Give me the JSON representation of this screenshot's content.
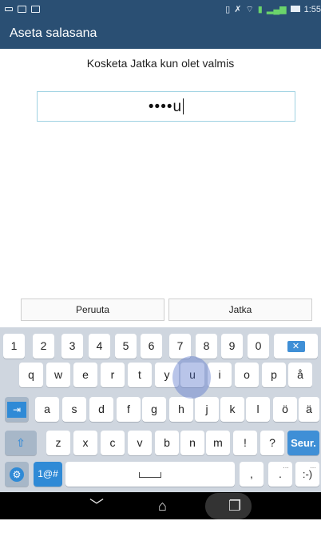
{
  "status_bar": {
    "time": "1:55",
    "icons": [
      "notification-icon",
      "image-icon",
      "vibrate-icon",
      "mute-icon",
      "wifi-icon",
      "sim-icon",
      "signal-icon",
      "battery-icon"
    ]
  },
  "app_bar": {
    "title": "Aseta salasana"
  },
  "prompt": "Kosketa Jatka kun olet valmis",
  "password_field": {
    "value": "••••u"
  },
  "buttons": {
    "cancel": "Peruuta",
    "next": "Jatka"
  },
  "keyboard": {
    "row1": [
      "1",
      "2",
      "3",
      "4",
      "5",
      "6",
      "7",
      "8",
      "9",
      "0"
    ],
    "row2": [
      "q",
      "w",
      "e",
      "r",
      "t",
      "y",
      "u",
      "i",
      "o",
      "p",
      "å"
    ],
    "row3": [
      "a",
      "s",
      "d",
      "f",
      "g",
      "h",
      "j",
      "k",
      "l",
      "ö",
      "ä"
    ],
    "row4": [
      "z",
      "x",
      "c",
      "v",
      "b",
      "n",
      "m",
      "!",
      "?"
    ],
    "enter_label": "Seur.",
    "symbols_label": "1@#",
    "comma": ",",
    "period": ".",
    "smiley": ":-)",
    "hint": "…"
  },
  "colors": {
    "header": "#2a4f73",
    "keyboard_bg": "#cfd6df",
    "accent": "#3f8fd6"
  }
}
